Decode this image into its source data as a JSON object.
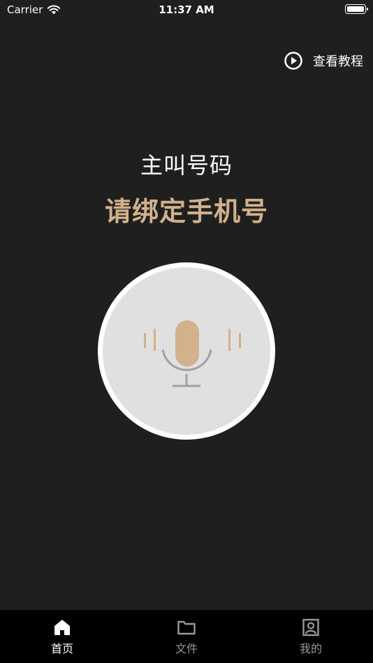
{
  "status_bar": {
    "carrier": "Carrier",
    "time": "11:37 AM"
  },
  "header": {
    "tutorial_label": "查看教程",
    "tutorial_icon": "play-circle-icon"
  },
  "main": {
    "caller_label": "主叫号码",
    "bind_prompt": "请绑定手机号",
    "mic_icon": "microphone-icon"
  },
  "tab_bar": {
    "tabs": [
      {
        "label": "首页",
        "icon": "home-icon",
        "active": true
      },
      {
        "label": "文件",
        "icon": "folder-icon",
        "active": false
      },
      {
        "label": "我的",
        "icon": "profile-icon",
        "active": false
      }
    ]
  },
  "colors": {
    "accent": "#d2b18b",
    "background": "#1f1f1f",
    "tab_bar": "#000000"
  }
}
